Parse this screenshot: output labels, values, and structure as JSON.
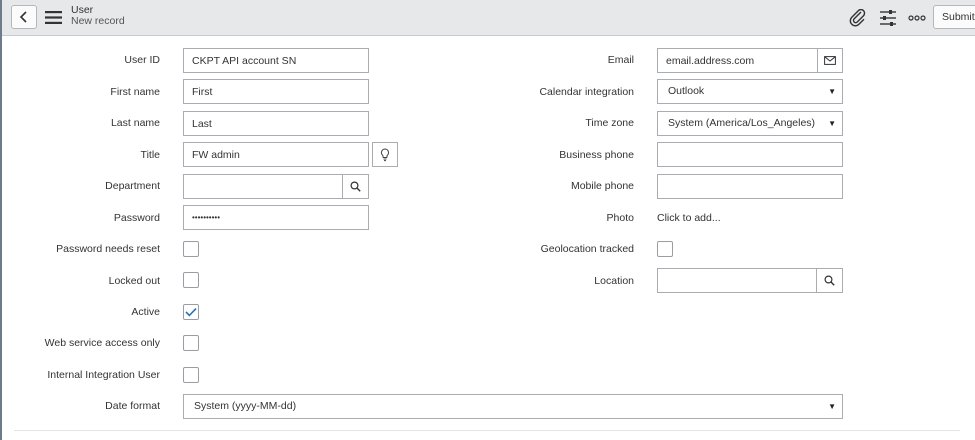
{
  "header": {
    "title": "User",
    "subtitle": "New record",
    "submit_label": "Submit"
  },
  "left_fields": {
    "user_id": {
      "label": "User ID",
      "value": "CKPT API account SN"
    },
    "first_name": {
      "label": "First name",
      "value": "First"
    },
    "last_name": {
      "label": "Last name",
      "value": "Last"
    },
    "title": {
      "label": "Title",
      "value": "FW admin"
    },
    "department": {
      "label": "Department",
      "value": ""
    },
    "password": {
      "label": "Password",
      "value": "••••••••••"
    },
    "password_needs_reset": {
      "label": "Password needs reset",
      "checked": false
    },
    "locked_out": {
      "label": "Locked out",
      "checked": false
    },
    "active": {
      "label": "Active",
      "checked": true
    },
    "web_service_access_only": {
      "label": "Web service access only",
      "checked": false
    },
    "internal_integration_user": {
      "label": "Internal Integration User",
      "checked": false
    },
    "date_format": {
      "label": "Date format",
      "value": "System (yyyy-MM-dd)"
    }
  },
  "right_fields": {
    "email": {
      "label": "Email",
      "value": "email.address.com"
    },
    "calendar_integration": {
      "label": "Calendar integration",
      "value": "Outlook"
    },
    "time_zone": {
      "label": "Time zone",
      "value": "System (America/Los_Angeles)"
    },
    "business_phone": {
      "label": "Business phone",
      "value": ""
    },
    "mobile_phone": {
      "label": "Mobile phone",
      "value": ""
    },
    "photo": {
      "label": "Photo",
      "value": "Click to add..."
    },
    "geolocation_tracked": {
      "label": "Geolocation tracked",
      "checked": false
    },
    "location": {
      "label": "Location",
      "value": ""
    }
  },
  "icons": {
    "back": "chevron-left-icon",
    "menu": "hamburger-menu-icon",
    "attachment": "paperclip-icon",
    "personalize": "sliders-icon",
    "more": "more-options-icon",
    "lightbulb": "lightbulb-icon",
    "search": "search-icon",
    "email": "envelope-icon",
    "check": "checkmark-icon"
  },
  "colors": {
    "header_bg": "#e6e8ea",
    "checkmark": "#2d6fb5",
    "border": "#a9acb0"
  }
}
